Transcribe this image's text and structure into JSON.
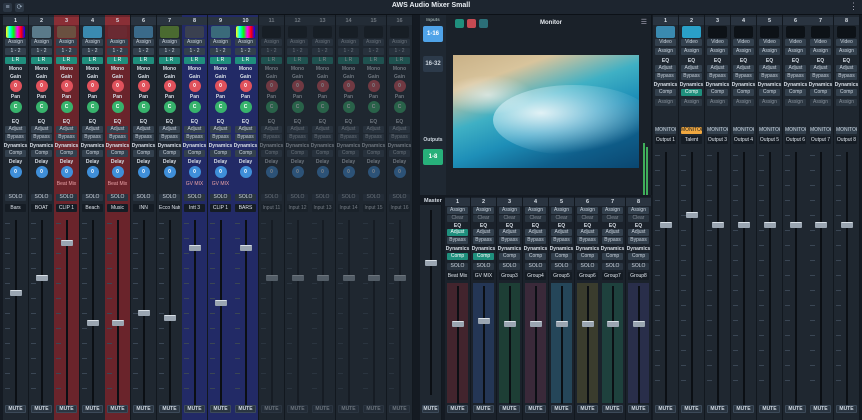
{
  "app": {
    "title": "AWS Audio Mixer Small"
  },
  "labels": {
    "mono": "Mono",
    "lr": "L R",
    "gain": "Gain",
    "pan": "Pan",
    "eq": "EQ",
    "adjust": "Adjust",
    "bypass": "Bypass",
    "dynamics": "Dynamics",
    "comp": "Comp",
    "delay": "Delay",
    "assign": "Assign",
    "solo": "SOLO",
    "mute": "MUTE",
    "video": "Video",
    "monitor_btn": "MONITOR",
    "clear": "Clear",
    "route": "1 - 2"
  },
  "inputs": [
    {
      "num": "1",
      "name": "Bars",
      "gain": "0",
      "pan": "C",
      "delay": "0",
      "thumb": "bars",
      "variant": "normal"
    },
    {
      "num": "2",
      "name": "BOAT",
      "gain": "0",
      "pan": "C",
      "delay": "0",
      "thumb": "boat",
      "variant": "normal"
    },
    {
      "num": "3",
      "name": "CLIP 1",
      "gain": "0",
      "pan": "C",
      "delay": "0",
      "thumb": "clip",
      "variant": "sel",
      "sub": "Beat Mix"
    },
    {
      "num": "4",
      "name": "Beach",
      "gain": "0",
      "pan": "C",
      "delay": "0",
      "thumb": "beach",
      "variant": "normal"
    },
    {
      "num": "5",
      "name": "Music",
      "gain": "0",
      "pan": "C",
      "delay": "0",
      "thumb": "music",
      "variant": "sel",
      "sub": "Beat Mix"
    },
    {
      "num": "6",
      "name": "INN",
      "gain": "0",
      "pan": "C",
      "delay": "0",
      "thumb": "inn",
      "variant": "normal"
    },
    {
      "num": "7",
      "name": "Ecco Nature",
      "gain": "0",
      "pan": "C",
      "delay": "0",
      "thumb": "nature",
      "variant": "normal"
    },
    {
      "num": "8",
      "name": "Intt 3",
      "gain": "0",
      "pan": "C",
      "delay": "0",
      "thumb": "intt",
      "variant": "blue",
      "sub": "GV MIX"
    },
    {
      "num": "9",
      "name": "CLIP 1",
      "gain": "0",
      "pan": "C",
      "delay": "0",
      "thumb": "clip2",
      "variant": "blue",
      "sub": "GV MIX"
    },
    {
      "num": "10",
      "name": "BARS",
      "gain": "0",
      "pan": "C",
      "delay": "0",
      "thumb": "bars",
      "variant": "blue"
    },
    {
      "num": "11",
      "name": "Input 11",
      "gain": "0",
      "pan": "C",
      "delay": "0",
      "thumb": "empty",
      "variant": "dim"
    },
    {
      "num": "12",
      "name": "Input 12",
      "gain": "0",
      "pan": "C",
      "delay": "0",
      "thumb": "empty",
      "variant": "dim"
    },
    {
      "num": "13",
      "name": "Input 13",
      "gain": "0",
      "pan": "C",
      "delay": "0",
      "thumb": "empty",
      "variant": "dim"
    },
    {
      "num": "14",
      "name": "Input 14",
      "gain": "0",
      "pan": "C",
      "delay": "0",
      "thumb": "empty",
      "variant": "dim"
    },
    {
      "num": "15",
      "name": "Input 15",
      "gain": "0",
      "pan": "C",
      "delay": "0",
      "thumb": "empty",
      "variant": "dim"
    },
    {
      "num": "16",
      "name": "Input 16",
      "gain": "0",
      "pan": "C",
      "delay": "0",
      "thumb": "empty",
      "variant": "dim"
    }
  ],
  "nav": {
    "inputs_label": "Inputs",
    "bank1": "1-16",
    "bank2": "16-32",
    "outputs_label": "Outputs",
    "outbank": "1-8"
  },
  "monitor": {
    "title": "Monitor"
  },
  "master": {
    "label": "Master"
  },
  "groups": [
    {
      "num": "1",
      "name": "Beat Mix"
    },
    {
      "num": "2",
      "name": "GV MIX"
    },
    {
      "num": "3",
      "name": "Group3"
    },
    {
      "num": "4",
      "name": "Group4"
    },
    {
      "num": "5",
      "name": "Group5"
    },
    {
      "num": "6",
      "name": "Group6"
    },
    {
      "num": "7",
      "name": "Group7"
    },
    {
      "num": "8",
      "name": "Group8"
    }
  ],
  "outputs": [
    {
      "num": "1",
      "name": "Output 1",
      "thumb": "beach",
      "mon": false
    },
    {
      "num": "2",
      "name": "Talent",
      "thumb": "sea",
      "mon": true
    },
    {
      "num": "3",
      "name": "Output 3",
      "thumb": "empty",
      "mon": false
    },
    {
      "num": "4",
      "name": "Output 4",
      "thumb": "empty",
      "mon": false
    },
    {
      "num": "5",
      "name": "Output 5",
      "thumb": "empty",
      "mon": false
    },
    {
      "num": "6",
      "name": "Output 6",
      "thumb": "empty",
      "mon": false
    },
    {
      "num": "7",
      "name": "Output 7",
      "thumb": "empty",
      "mon": false
    },
    {
      "num": "8",
      "name": "Output 8",
      "thumb": "empty",
      "mon": false
    }
  ],
  "colors": {
    "accent_teal": "#1f8f7d",
    "selected_red": "#6a242b",
    "group_blue": "#222a66",
    "nav_active": "#4fa3e8",
    "monitor_orange": "#f0a840"
  }
}
